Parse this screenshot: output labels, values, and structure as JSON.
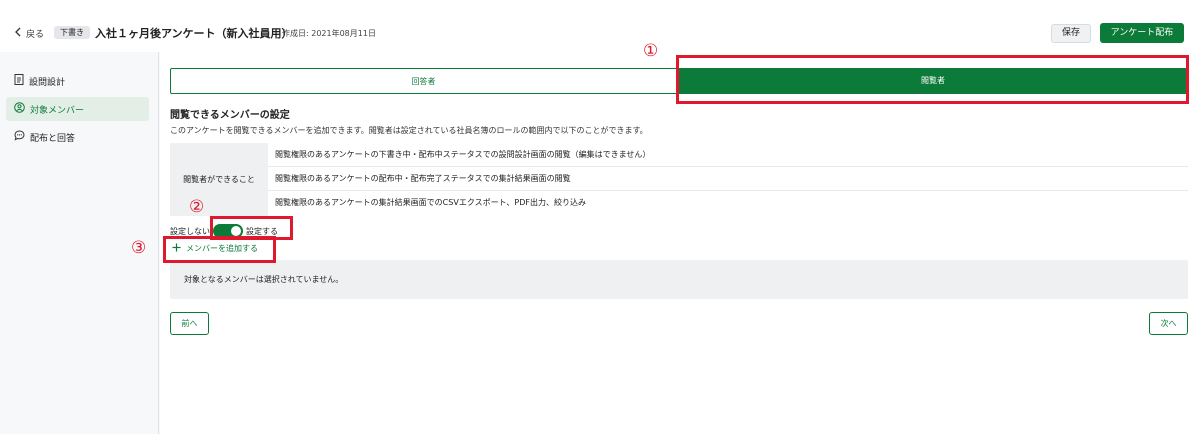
{
  "header": {
    "back_label": "戻る",
    "status_badge": "下書き",
    "title": "入社１ヶ月後アンケート（新入社員用）",
    "created": "作成日: 2021年08月11日",
    "save_label": "保存",
    "distribute_label": "アンケート配布"
  },
  "sidebar": {
    "items": [
      {
        "label": "設問設計",
        "icon": "document-icon",
        "active": false
      },
      {
        "label": "対象メンバー",
        "icon": "user-circle-icon",
        "active": true
      },
      {
        "label": "配布と回答",
        "icon": "chat-icon",
        "active": false
      }
    ]
  },
  "tabs": [
    {
      "label": "回答者",
      "active": false
    },
    {
      "label": "閲覧者",
      "active": true
    }
  ],
  "annotations": [
    "①",
    "②",
    "③"
  ],
  "section": {
    "title": "閲覧できるメンバーの設定",
    "description": "このアンケートを閲覧できるメンバーを追加できます。閲覧者は設定されている社員名簿のロールの範囲内で以下のことができます。"
  },
  "permissions": {
    "header": "閲覧者ができること",
    "rows": [
      "閲覧権限のあるアンケートの下書き中・配布中ステータスでの設問設計画面の閲覧（編集はできません）",
      "閲覧権限のあるアンケートの配布中・配布完了ステータスでの集計結果画面の閲覧",
      "閲覧権限のあるアンケートの集計結果画面でのCSVエクスポート、PDF出力、絞り込み"
    ]
  },
  "toggle": {
    "off_label": "設定しない",
    "on_label": "設定する",
    "state": true
  },
  "add_member_label": "メンバーを追加する",
  "empty_message": "対象となるメンバーは選択されていません。",
  "nav": {
    "prev_label": "前へ",
    "next_label": "次へ"
  },
  "colors": {
    "brand_green": "#0c7a38",
    "annotation_red": "#e0182d"
  }
}
